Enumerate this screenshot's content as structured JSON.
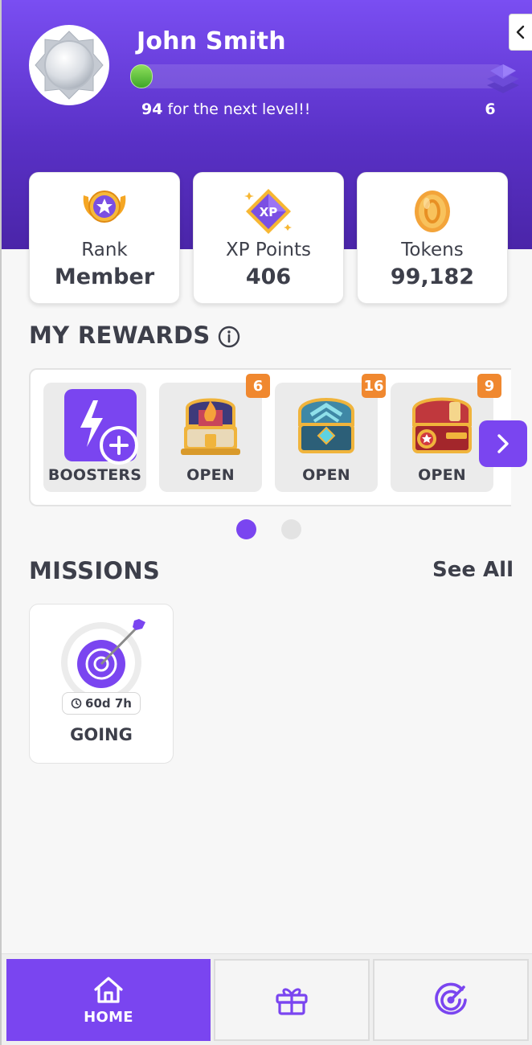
{
  "profile": {
    "name": "John Smith",
    "progress_fraction": 0.06,
    "next_level_points": "94",
    "next_level_text": " for the next level!!",
    "level": "6"
  },
  "stats": [
    {
      "label": "Rank",
      "value": "Member",
      "icon": "rank-wings-star-icon"
    },
    {
      "label": "XP Points",
      "value": "406",
      "icon": "xp-diamond-icon",
      "icon_text": "XP"
    },
    {
      "label": "Tokens",
      "value": "99,182",
      "icon": "token-coin-icon"
    }
  ],
  "rewards": {
    "title": "MY REWARDS",
    "items": [
      {
        "label": "BOOSTERS",
        "icon": "lightning-plus-icon",
        "badge": ""
      },
      {
        "label": "OPEN",
        "icon": "trophy-chest-icon",
        "badge": "6"
      },
      {
        "label": "OPEN",
        "icon": "blue-chest-icon",
        "badge": "16"
      },
      {
        "label": "OPEN",
        "icon": "red-chest-icon",
        "badge": "9"
      }
    ],
    "page_index": 0,
    "page_count": 2
  },
  "missions": {
    "title": "MISSIONS",
    "see_all": "See All",
    "items": [
      {
        "timer": "60d 7h",
        "status": "GOING",
        "icon": "target-arrow-icon"
      }
    ]
  },
  "nav": {
    "items": [
      {
        "label": "HOME",
        "icon": "home-icon",
        "active": true
      },
      {
        "label": "",
        "icon": "gift-icon",
        "active": false
      },
      {
        "label": "",
        "icon": "target-icon",
        "active": false
      }
    ]
  },
  "colors": {
    "accent": "#7a45f0",
    "header_top": "#7a4ef2",
    "badge": "#f0882f",
    "text": "#3d3f4a"
  }
}
